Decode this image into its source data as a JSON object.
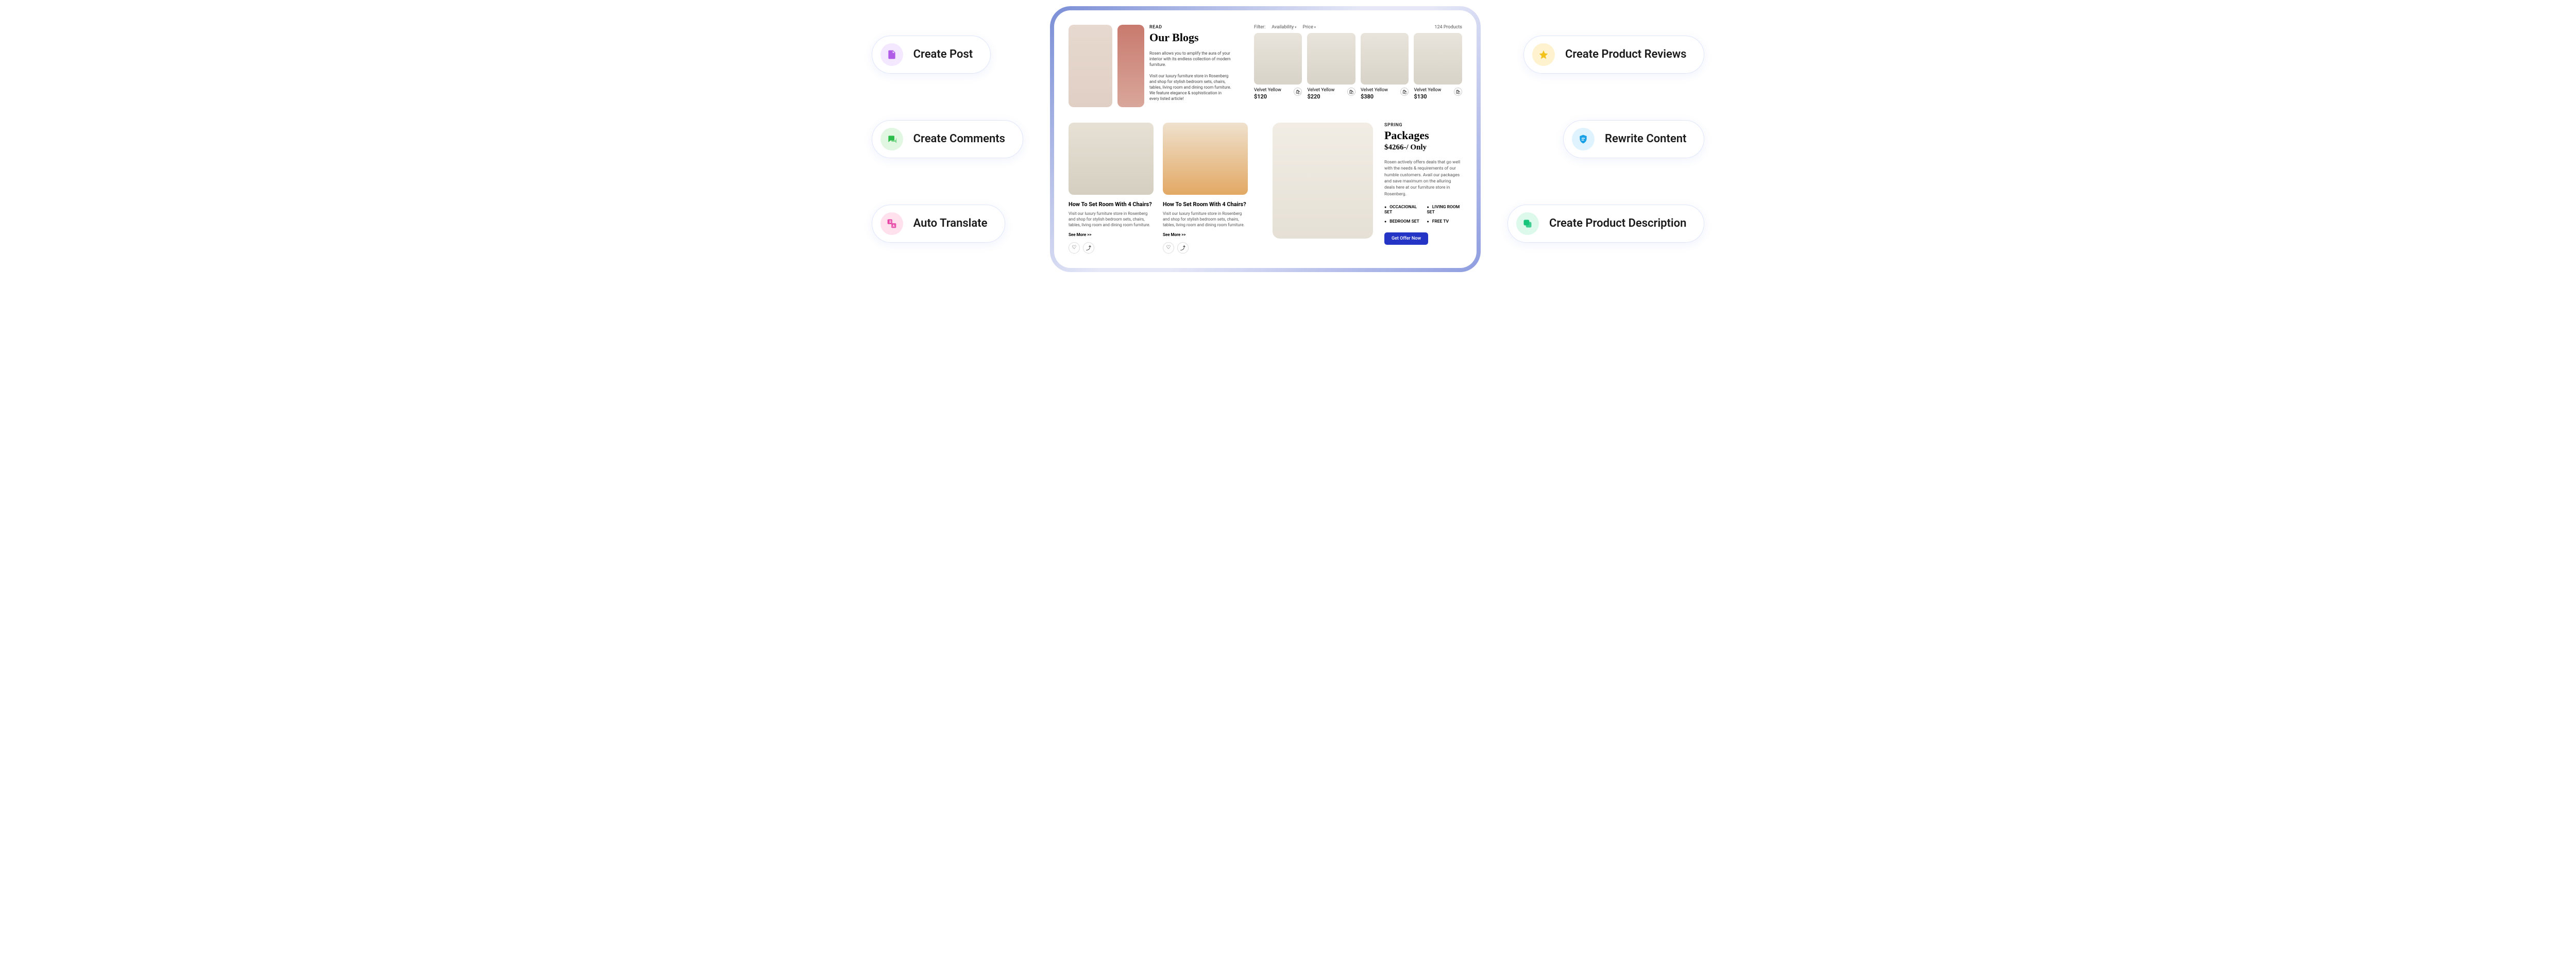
{
  "pills": {
    "create_post": "Create Post",
    "create_comments": "Create Comments",
    "auto_translate": "Auto Translate",
    "create_reviews": "Create Product Reviews",
    "rewrite_content": "Rewrite Content",
    "create_desc": "Create Product Description"
  },
  "blogs": {
    "eyebrow": "READ",
    "title": "Our Blogs",
    "p1": "Rosen allows you to amplify the aura of your interior with its endless collection of modern furniture.",
    "p2": "Visit our luxury furniture store in Rosenberg and shop for stylish bedroom sets, chairs, tables, living room and dining room furniture. We feature elegance & sophistication in every listed article!"
  },
  "catalog": {
    "filter_label": "Filter:",
    "availability": "Availability",
    "price": "Price",
    "count": "124 Products",
    "products": [
      {
        "name": "Velvet Yellow",
        "price": "$120"
      },
      {
        "name": "Velvet Yellow",
        "price": "$220"
      },
      {
        "name": "Velvet Yellow",
        "price": "$380"
      },
      {
        "name": "Velvet Yellow",
        "price": "$130"
      }
    ]
  },
  "posts": [
    {
      "title": "How To Set Room With 4 Chairs?",
      "body": "Visit our luxury furniture store in Rosenberg and shop for stylish bedroom sets, chairs, tables, living room and dining room furniture.",
      "see_more": "See More >>"
    },
    {
      "title": "How To Set Room With 4 Chairs?",
      "body": "Visit our luxury furniture store in Rosenberg and shop for stylish bedroom sets, chairs, tables, living room and dining room furniture.",
      "see_more": "See More >>"
    }
  ],
  "promo": {
    "eyebrow": "SPRING",
    "title": "Packages",
    "price": "$4266-/ Only",
    "body": "Rosen actively offers deals that go well with the needs & requirements of our humble customers. Avail our packages and save maximum on the alluring deals here at our furniture store in Rosenberg.",
    "features": [
      "OCCACIONAL SET",
      "LIVING ROOM SET",
      "BEDROOM SET",
      "FREE TV"
    ],
    "cta": "Get Offer Now"
  }
}
